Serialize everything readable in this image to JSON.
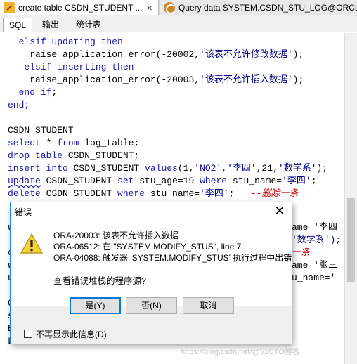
{
  "doc_tabs": [
    {
      "label": "create table CSDN_STUDENT ...",
      "close": "×"
    },
    {
      "label": "Query data SYSTEM.CSDN_STU_LOG@ORCL"
    }
  ],
  "sub_tabs": [
    "SQL",
    "输出",
    "统计表"
  ],
  "editor": {
    "lines": [
      [
        "  ",
        "elsif updating then"
      ],
      [
        "    raise_application_error(-20002,'该表不允许修改数据');"
      ],
      [
        "   elsif inserting then"
      ],
      [
        "    raise_application_error(-20003,'该表不允许插入数据');"
      ],
      [
        "  end if;"
      ],
      [
        "end;"
      ],
      [
        ""
      ],
      [
        "CSDN_STUDENT"
      ],
      [
        "select * from log_table;"
      ],
      [
        "drop table CSDN_STUDENT;"
      ],
      [
        "insert into CSDN_STUDENT values(1,'NO2','李四',21,'数学系');"
      ],
      [
        "update CSDN_STUDENT set stu_age=19 where stu_name='李四';"
      ],
      [
        "delete CSDN_STUDENT where stu_name='李四';   --删除一条"
      ]
    ],
    "partial_right": [
      "ame='李四",
      "'数学系');",
      "一条",
      "ame='张三",
      "u_name='"
    ]
  },
  "dialog": {
    "title": "错误",
    "close": "✕",
    "messages": [
      "ORA-20003: 该表不允许插入数据",
      "ORA-06512: 在 \"SYSTEM.MODIFY_STUS\", line 7",
      "ORA-04088: 触发器 'SYSTEM.MODIFY_STUS' 执行过程中出错"
    ],
    "question": "查看错误堆栈的程序源?",
    "buttons": {
      "yes": "是(Y)",
      "no": "否(N)",
      "cancel": "取消"
    },
    "checkbox_label": "不再显示此信息(D)"
  },
  "watermark": "https://blog.csdn.net/@51CTO博客"
}
